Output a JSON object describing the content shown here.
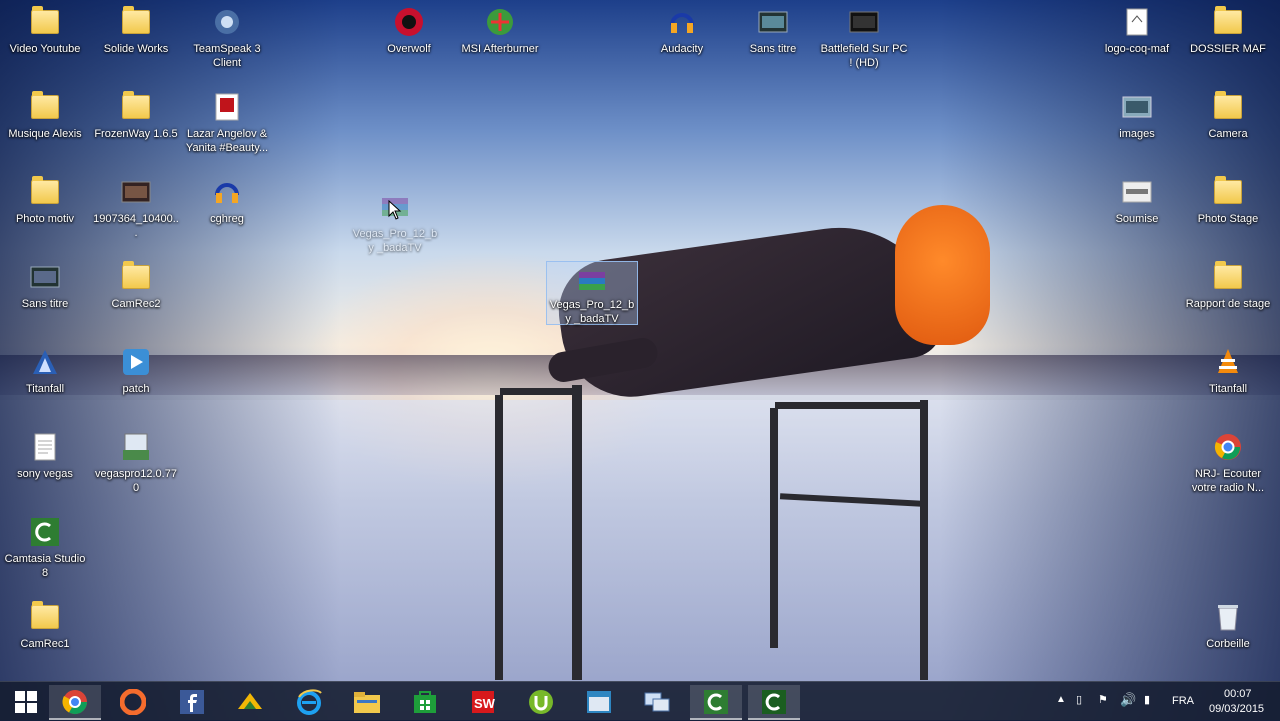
{
  "desktop_icons": [
    {
      "label": "Video Youtube",
      "icon": "folder-icon"
    },
    {
      "label": "Solide Works",
      "icon": "folder-icon"
    },
    {
      "label": "TeamSpeak 3 Client",
      "icon": "teamspeak-icon"
    },
    {
      "label": "Overwolf",
      "icon": "overwolf-icon"
    },
    {
      "label": "MSI Afterburner",
      "icon": "afterburner-icon"
    },
    {
      "label": "Audacity",
      "icon": "audacity-icon"
    },
    {
      "label": "Sans titre",
      "icon": "video-icon"
    },
    {
      "label": "Battlefield Sur PC ! (HD)",
      "icon": "video-icon"
    },
    {
      "label": "logo-coq-maf",
      "icon": "image-file-icon"
    },
    {
      "label": "DOSSIER MAF",
      "icon": "folder-icon"
    },
    {
      "label": "Musique Alexis",
      "icon": "folder-icon"
    },
    {
      "label": "FrozenWay 1.6.5",
      "icon": "folder-icon"
    },
    {
      "label": "Lazar Angelov & Yanita #Beauty...",
      "icon": "pdf-icon"
    },
    {
      "label": "images",
      "icon": "image-file-icon"
    },
    {
      "label": "Camera",
      "icon": "folder-icon"
    },
    {
      "label": "Photo motiv",
      "icon": "folder-icon"
    },
    {
      "label": "1907364_10400...",
      "icon": "video-icon"
    },
    {
      "label": "cghreg",
      "icon": "audacity-icon"
    },
    {
      "label": "Vegas_Pro_12_by _badaTV",
      "icon": "rar-icon"
    },
    {
      "label": "Soumise",
      "icon": "image-file-icon"
    },
    {
      "label": "Photo Stage",
      "icon": "folder-icon"
    },
    {
      "label": "Vegas_Pro_12_by _badaTV",
      "icon": "rar-icon"
    },
    {
      "label": "Sans titre",
      "icon": "video-icon"
    },
    {
      "label": "CamRec2",
      "icon": "folder-icon"
    },
    {
      "label": "Rapport de stage",
      "icon": "folder-icon"
    },
    {
      "label": "Titanfall",
      "icon": "titanfall-icon"
    },
    {
      "label": "patch",
      "icon": "patch-icon"
    },
    {
      "label": "Titanfall",
      "icon": "vlc-icon"
    },
    {
      "label": "sony vegas",
      "icon": "text-file-icon"
    },
    {
      "label": "vegaspro12.0.770",
      "icon": "installer-icon"
    },
    {
      "label": "NRJ- Ecouter votre radio N...",
      "icon": "chrome-icon"
    },
    {
      "label": "Camtasia Studio 8",
      "icon": "camtasia-icon"
    },
    {
      "label": "CamRec1",
      "icon": "folder-icon"
    },
    {
      "label": "Corbeille",
      "icon": "recycle-bin-icon"
    }
  ],
  "taskbar": {
    "apps": [
      {
        "name": "chrome",
        "icon": "chrome-icon",
        "active": true
      },
      {
        "name": "origin",
        "icon": "origin-icon",
        "active": false
      },
      {
        "name": "facebook",
        "icon": "facebook-icon",
        "active": false
      },
      {
        "name": "scripting",
        "icon": "tool-icon",
        "active": false
      },
      {
        "name": "internet-explorer",
        "icon": "ie-icon",
        "active": false
      },
      {
        "name": "file-explorer",
        "icon": "folder-icon",
        "active": false
      },
      {
        "name": "store",
        "icon": "store-icon",
        "active": false
      },
      {
        "name": "solidworks",
        "icon": "solidworks-icon",
        "active": false
      },
      {
        "name": "utorrent",
        "icon": "utorrent-icon",
        "active": false
      },
      {
        "name": "app-window",
        "icon": "window-icon",
        "active": false
      },
      {
        "name": "remote",
        "icon": "network-icon",
        "active": false
      },
      {
        "name": "camtasia-recorder",
        "icon": "camtasia-icon",
        "active": true
      },
      {
        "name": "camtasia",
        "icon": "camtasia-icon",
        "active": true
      }
    ],
    "tray": {
      "language": "FRA",
      "time": "00:07",
      "date": "09/03/2015"
    }
  }
}
